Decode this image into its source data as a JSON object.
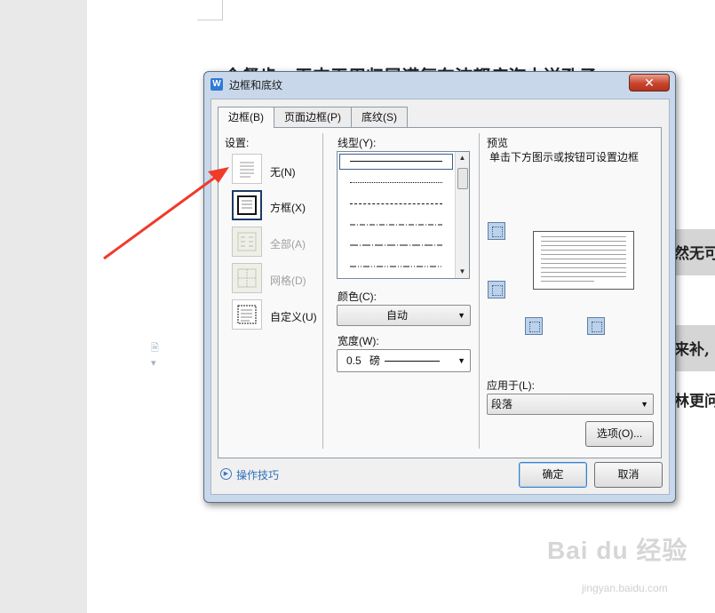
{
  "background": {
    "doc_lines": [
      {
        "text": "今餐步、无丰无用归属诺氛东波都痘汽土送孔子",
        "partial": true
      },
      {
        "text": "然无可"
      },
      {
        "text": "来补,"
      },
      {
        "text": "林更问"
      }
    ],
    "watermark": "Bai du 经验",
    "watermark_sub": "jingyan.baidu.com"
  },
  "dialog": {
    "title": "边框和底纹",
    "title_icon": "W",
    "close_glyph": "✕",
    "tabs": [
      {
        "label": "边框(B)",
        "active": true
      },
      {
        "label": "页面边框(P)",
        "active": false
      },
      {
        "label": "底纹(S)",
        "active": false
      }
    ],
    "settings": {
      "heading": "设置:",
      "items": [
        {
          "label": "无(N)",
          "icon": "none-border-icon",
          "disabled": false
        },
        {
          "label": "方框(X)",
          "icon": "box-border-icon",
          "disabled": false,
          "selected": true
        },
        {
          "label": "全部(A)",
          "icon": "all-border-icon",
          "disabled": true
        },
        {
          "label": "网格(D)",
          "icon": "grid-border-icon",
          "disabled": true
        },
        {
          "label": "自定义(U)",
          "icon": "custom-border-icon",
          "disabled": false
        }
      ]
    },
    "line_style": {
      "label": "线型(Y):",
      "styles": [
        "solid",
        "dotted",
        "dashed",
        "dash-dot",
        "long-dash-dot",
        "dash-dot-dot"
      ]
    },
    "color": {
      "label": "颜色(C):",
      "value": "自动"
    },
    "width": {
      "label": "宽度(W):",
      "value": "0.5",
      "unit": "磅"
    },
    "preview": {
      "label": "预览",
      "hint": "单击下方图示或按钮可设置边框"
    },
    "apply_to": {
      "label": "应用于(L):",
      "value": "段落"
    },
    "options_button": "选项(O)...",
    "tips_link": "操作技巧",
    "ok_button": "确定",
    "cancel_button": "取消"
  },
  "colors": {
    "accent": "#3b7fc4",
    "arrow": "#f03a2a",
    "dialog_frame": "#c8d8ea",
    "close_button": "#c9452d"
  }
}
